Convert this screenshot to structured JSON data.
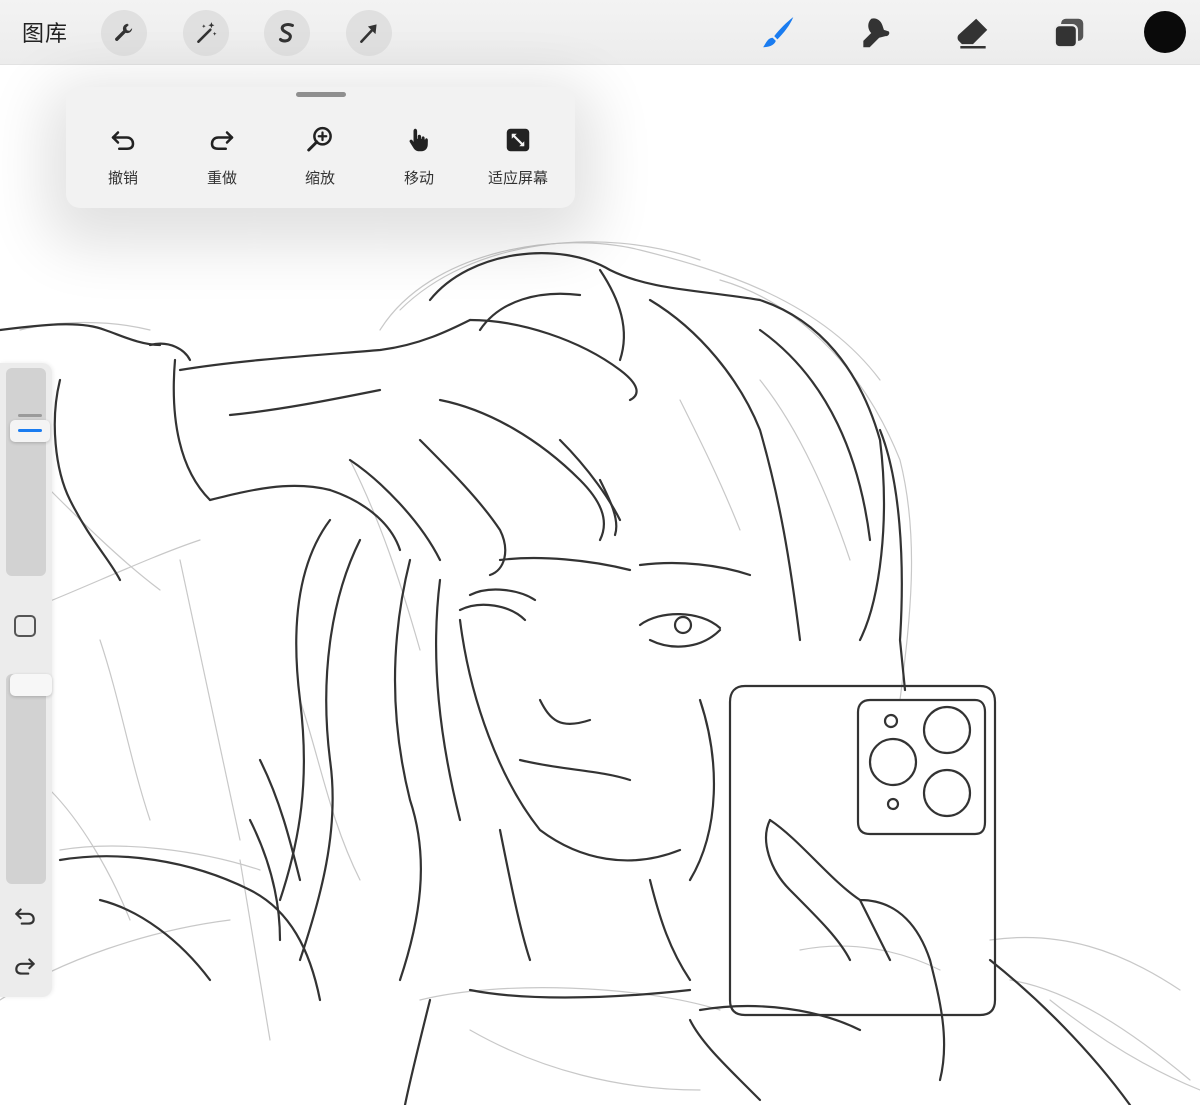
{
  "toolbar": {
    "gallery_label": "图库",
    "left_tools": [
      "wrench-icon",
      "magic-wand-icon",
      "selection-s-icon",
      "transform-arrow-icon"
    ],
    "right_tools": [
      "brush-icon",
      "smudge-icon",
      "eraser-icon",
      "layers-icon"
    ],
    "active_tool": "brush-icon",
    "active_tool_color": "#1a7cf0",
    "current_color": "#0a0a0a"
  },
  "quick_menu": {
    "items": [
      {
        "label": "撤销",
        "icon": "undo-icon"
      },
      {
        "label": "重做",
        "icon": "redo-icon"
      },
      {
        "label": "缩放",
        "icon": "zoom-icon"
      },
      {
        "label": "移动",
        "icon": "hand-icon"
      },
      {
        "label": "适应屏幕",
        "icon": "fit-screen-icon"
      }
    ]
  },
  "sidebar": {
    "brush_size_level": 0.72,
    "opacity_level": 1.0,
    "accent": "#1a7cf0"
  }
}
